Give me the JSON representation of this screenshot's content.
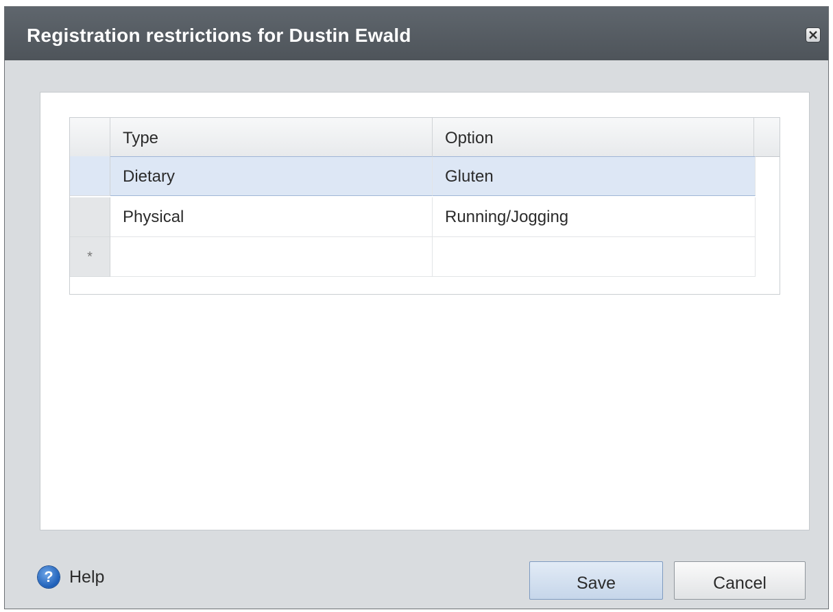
{
  "dialog": {
    "title": "Registration restrictions for Dustin Ewald",
    "close_icon": "close-icon"
  },
  "grid": {
    "columns": [
      "Type",
      "Option"
    ],
    "rows": [
      {
        "type": "Dietary",
        "option": "Gluten",
        "selected": true
      },
      {
        "type": "Physical",
        "option": "Running/Jogging",
        "selected": false
      }
    ],
    "new_row_marker": "*"
  },
  "footer": {
    "help_icon": "help-icon",
    "help_label": "Help",
    "save_label": "Save",
    "cancel_label": "Cancel"
  },
  "colors": {
    "titlebar": "#545b61",
    "selected_row": "#dde7f5",
    "dialog_bg": "#d9dcdf"
  }
}
